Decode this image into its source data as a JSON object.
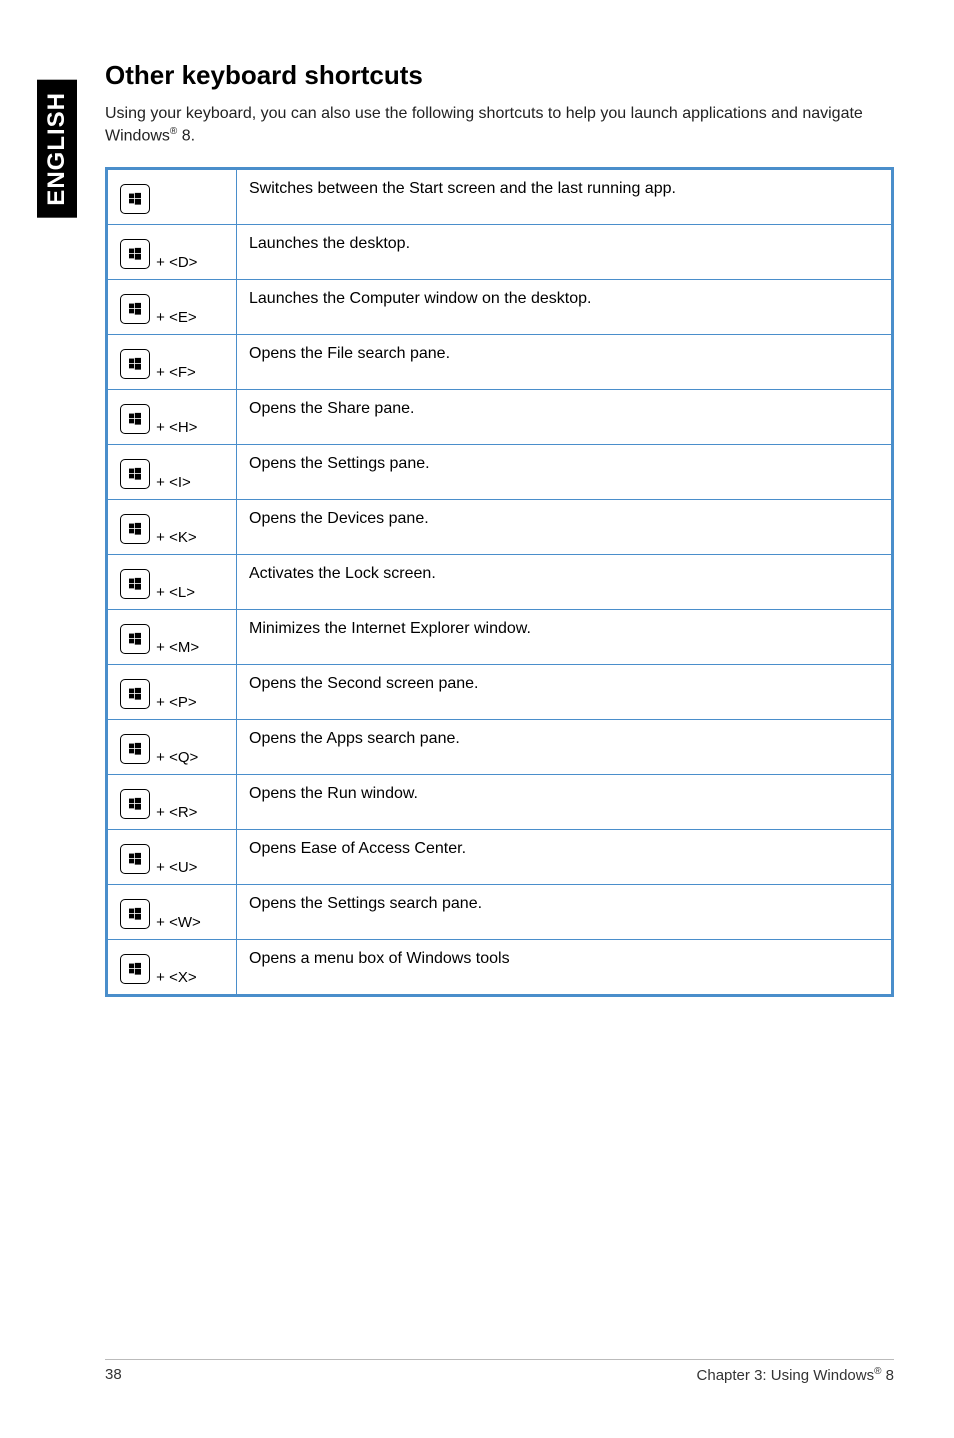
{
  "side_tab": "ENGLISH",
  "heading": "Other keyboard shortcuts",
  "intro_prefix": "Using your keyboard, you can also use the following shortcuts to help you launch applications and navigate Windows",
  "intro_reg": "®",
  "intro_suffix": " 8.",
  "rows": [
    {
      "key_suffix": "",
      "desc": "Switches between the Start screen and the last running app."
    },
    {
      "key_suffix": " + <D>",
      "desc": "Launches the desktop."
    },
    {
      "key_suffix": " + <E>",
      "desc": "Launches the Computer window on the desktop."
    },
    {
      "key_suffix": " + <F>",
      "desc": "Opens the File search pane."
    },
    {
      "key_suffix": " + <H>",
      "desc": "Opens the Share pane."
    },
    {
      "key_suffix": " + <I>",
      "desc": "Opens the Settings pane."
    },
    {
      "key_suffix": " + <K>",
      "desc": "Opens the Devices pane."
    },
    {
      "key_suffix": " + <L>",
      "desc": "Activates the Lock screen."
    },
    {
      "key_suffix": " + <M>",
      "desc": "Minimizes the Internet Explorer window."
    },
    {
      "key_suffix": " + <P>",
      "desc": "Opens the Second screen pane."
    },
    {
      "key_suffix": " + <Q>",
      "desc": "Opens the Apps search pane."
    },
    {
      "key_suffix": " + <R>",
      "desc": "Opens the Run window."
    },
    {
      "key_suffix": " + <U>",
      "desc": "Opens Ease of Access Center."
    },
    {
      "key_suffix": " + <W>",
      "desc": "Opens the Settings search pane."
    },
    {
      "key_suffix": " + <X>",
      "desc": "Opens a menu box of Windows tools"
    }
  ],
  "footer": {
    "page_number": "38",
    "chapter_prefix": "Chapter 3: Using Windows",
    "chapter_reg": "®",
    "chapter_suffix": " 8"
  }
}
